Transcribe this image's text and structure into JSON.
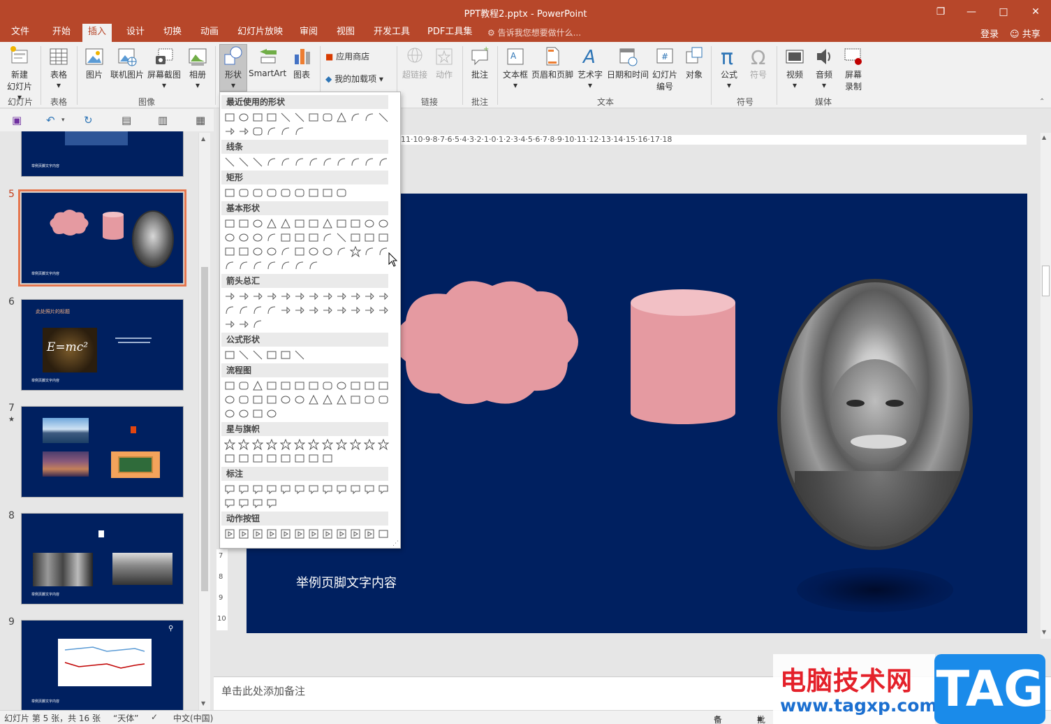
{
  "window": {
    "title": "PPT教程2.pptx - PowerPoint",
    "controls": [
      "restore-icon",
      "minimize-icon",
      "maximize-icon",
      "close-icon"
    ]
  },
  "menu": {
    "tabs": [
      "文件",
      "开始",
      "插入",
      "设计",
      "切换",
      "动画",
      "幻灯片放映",
      "审阅",
      "视图",
      "开发工具",
      "PDF工具集"
    ],
    "active_tab": "插入",
    "tell_me": "告诉我您想要做什么...",
    "login": "登录",
    "share": "共享"
  },
  "ribbon": {
    "buttons": {
      "new_slide": "新建",
      "new_slide2": "幻灯片",
      "table": "表格",
      "picture": "图片",
      "online_picture": "联机图片",
      "screenshot": "屏幕截图",
      "album": "相册",
      "shapes": "形状",
      "smartart": "SmartArt",
      "chart": "图表",
      "store": "应用商店",
      "my_addins": "我的加载项",
      "hyperlink": "超链接",
      "action": "动作",
      "comment": "批注",
      "textbox": "文本框",
      "header_footer": "页眉和页脚",
      "wordart": "艺术字",
      "datetime": "日期和时间",
      "slide_number": "幻灯片",
      "slide_number2": "编号",
      "object": "对象",
      "equation": "公式",
      "symbol": "符号",
      "video": "视频",
      "audio": "音频",
      "screen_record": "屏幕",
      "screen_record2": "录制"
    },
    "groups": [
      "幻灯片",
      "表格",
      "图像",
      "链接",
      "批注",
      "文本",
      "符号",
      "媒体"
    ]
  },
  "shapes_menu": {
    "categories": [
      "最近使用的形状",
      "线条",
      "矩形",
      "基本形状",
      "箭头总汇",
      "公式形状",
      "流程图",
      "星与旗帜",
      "标注",
      "动作按钮"
    ]
  },
  "ruler_h": "11·10·9·8·7·6·5·4·3·2·1·0·1·2·3·4·5·6·7·8·9·10·11·12·13·14·15·16·17·18",
  "ruler_v_labels": [
    "7",
    "8",
    "9",
    "10"
  ],
  "thumbnails": {
    "numbers": [
      "5",
      "6",
      "7",
      "8",
      "9"
    ],
    "star_marker": "★",
    "slide6_title": "此处照片的标题",
    "slide6_formula": "E=mc²",
    "footer_tiny": "举例页脚文字内容"
  },
  "slide": {
    "footer": "举例页脚文字内容"
  },
  "notes_placeholder": "单击此处添加备注",
  "status": {
    "slide_info": "幻灯片 第 5 张，共 16 张",
    "theme": "“天体”",
    "language": "中文(中国)",
    "notes_btn": "备注",
    "comments_btn": "批注"
  },
  "watermark": {
    "cn": "电脑技术网",
    "url": "www.tagxp.com",
    "tag": "TAG"
  },
  "colors": {
    "accent": "#b7472a",
    "slide_bg": "#002060",
    "shape_fill": "#e59aa1",
    "selection": "#e5774f"
  }
}
